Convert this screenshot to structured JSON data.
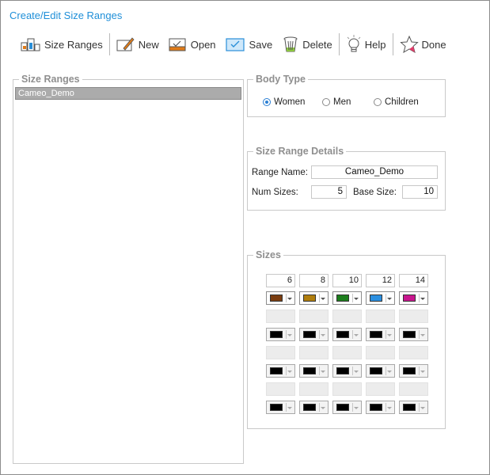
{
  "window": {
    "title": "Create/Edit Size Ranges"
  },
  "toolbar": {
    "size_ranges": "Size Ranges",
    "new": "New",
    "open": "Open",
    "save": "Save",
    "delete": "Delete",
    "help": "Help",
    "done": "Done"
  },
  "size_ranges_panel": {
    "legend": "Size Ranges",
    "items": [
      "Cameo_Demo"
    ]
  },
  "body_type": {
    "legend": "Body Type",
    "options": [
      "Women",
      "Men",
      "Children"
    ],
    "selected": "Women"
  },
  "details": {
    "legend": "Size Range Details",
    "range_name_label": "Range Name:",
    "range_name_value": "Cameo_Demo",
    "num_sizes_label": "Num Sizes:",
    "num_sizes_value": "5",
    "base_size_label": "Base Size:",
    "base_size_value": "10"
  },
  "sizes": {
    "legend": "Sizes",
    "values": [
      "6",
      "8",
      "10",
      "12",
      "14"
    ],
    "colors": [
      "#7a3d10",
      "#b07d0c",
      "#1c7d1c",
      "#2b8fe0",
      "#c8168e"
    ],
    "placeholder_color": "#000000"
  }
}
